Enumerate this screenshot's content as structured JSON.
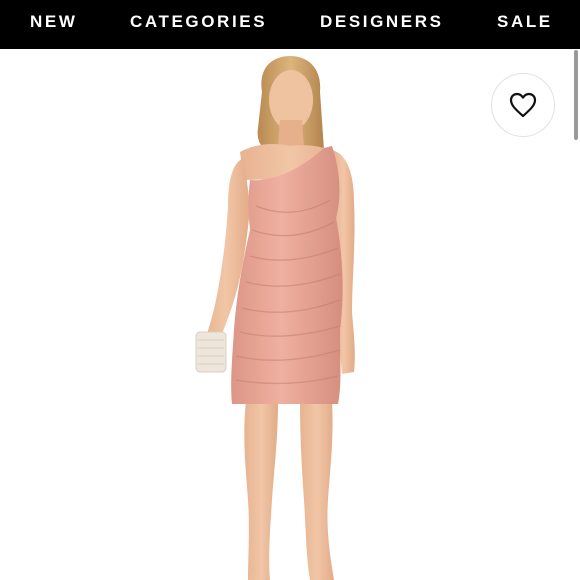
{
  "nav": {
    "items": [
      {
        "label": "NEW"
      },
      {
        "label": "CATEGORIES"
      },
      {
        "label": "DESIGNERS"
      },
      {
        "label": "SALE"
      }
    ],
    "background": "#000000",
    "text_color": "#ffffff"
  },
  "product": {
    "dress_color": "#e8a394",
    "wishlist_icon": "heart-icon"
  }
}
